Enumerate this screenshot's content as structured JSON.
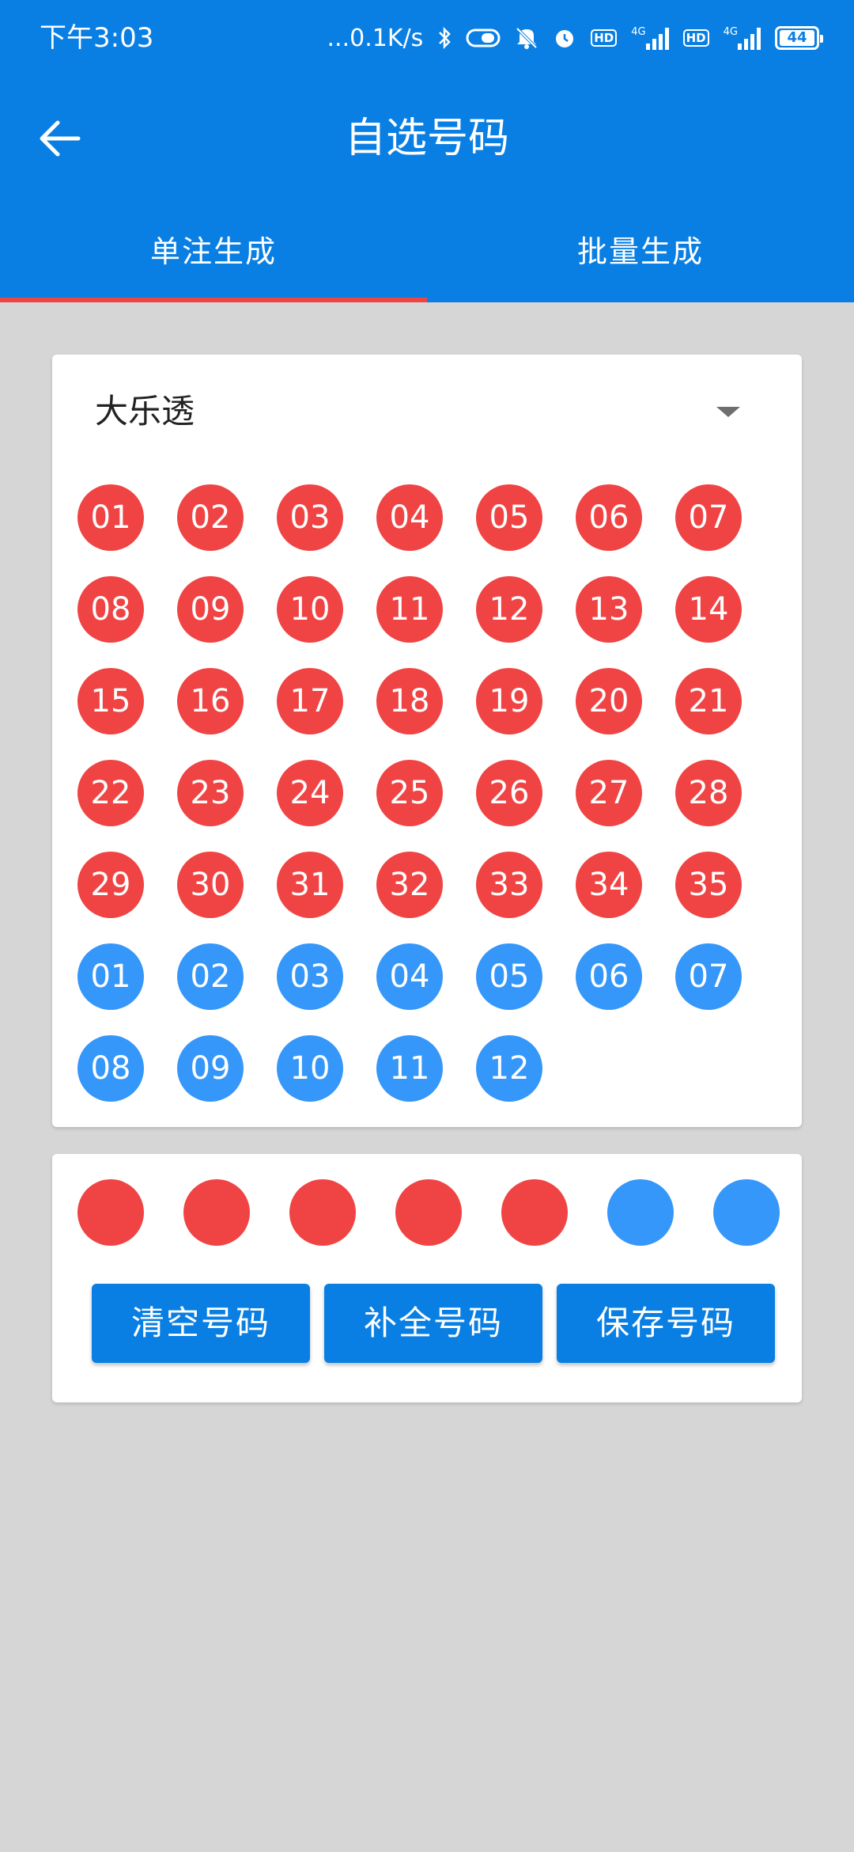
{
  "status_bar": {
    "time": "下午3:03",
    "network_speed": "...0.1K/s",
    "icons": [
      "bluetooth-icon",
      "toggle-icon",
      "mute-icon",
      "alarm-icon",
      "hd-icon",
      "signal-4g-icon",
      "hd-icon",
      "signal-4g-icon"
    ],
    "hd_label": "HD",
    "net_label": "4G",
    "battery": "44"
  },
  "header": {
    "title": "自选号码",
    "back_icon": "arrow-left-icon"
  },
  "tabs": [
    {
      "label": "单注生成",
      "active": true
    },
    {
      "label": "批量生成",
      "active": false
    }
  ],
  "selector": {
    "value": "大乐透"
  },
  "red_numbers": [
    "01",
    "02",
    "03",
    "04",
    "05",
    "06",
    "07",
    "08",
    "09",
    "10",
    "11",
    "12",
    "13",
    "14",
    "15",
    "16",
    "17",
    "18",
    "19",
    "20",
    "21",
    "22",
    "23",
    "24",
    "25",
    "26",
    "27",
    "28",
    "29",
    "30",
    "31",
    "32",
    "33",
    "34",
    "35"
  ],
  "blue_numbers": [
    "01",
    "02",
    "03",
    "04",
    "05",
    "06",
    "07",
    "08",
    "09",
    "10",
    "11",
    "12"
  ],
  "picked_slots": [
    "red",
    "red",
    "red",
    "red",
    "red",
    "blue",
    "blue"
  ],
  "actions": {
    "clear": "清空号码",
    "fill": "补全号码",
    "save": "保存号码"
  },
  "colors": {
    "primary": "#0a7fe3",
    "red_ball": "#f04444",
    "blue_ball": "#3597fa",
    "tab_indicator": "#ee4444",
    "background": "#d6d6d6"
  }
}
